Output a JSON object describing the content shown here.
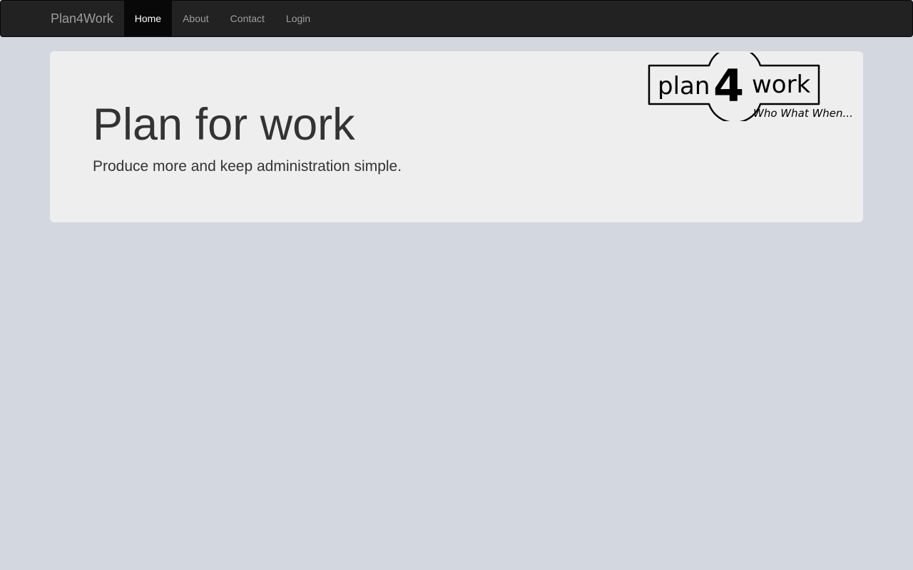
{
  "navbar": {
    "brand": "Plan4Work",
    "items": [
      {
        "label": "Home",
        "active": true
      },
      {
        "label": "About",
        "active": false
      },
      {
        "label": "Contact",
        "active": false
      },
      {
        "label": "Login",
        "active": false
      }
    ]
  },
  "jumbotron": {
    "title": "Plan for work",
    "lead": "Produce more and keep administration simple."
  },
  "logo": {
    "word_left": "plan",
    "digit": "4",
    "word_right": "work",
    "tagline": "Who What When..."
  },
  "colors": {
    "navbar_bg": "#222222",
    "nav_active_bg": "#080808",
    "nav_text": "#9d9d9d",
    "page_bg": "#d3d7df",
    "jumbotron_bg": "#eeeeee",
    "text": "#333333"
  }
}
